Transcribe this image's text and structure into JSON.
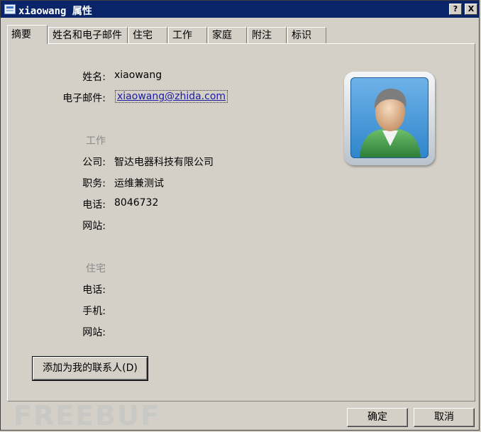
{
  "window": {
    "title": "xiaowang 属性",
    "help_label": "?",
    "close_label": "X"
  },
  "tabs": [
    {
      "label": "摘要",
      "active": true
    },
    {
      "label": "姓名和电子邮件"
    },
    {
      "label": "住宅"
    },
    {
      "label": "工作"
    },
    {
      "label": "家庭"
    },
    {
      "label": "附注"
    },
    {
      "label": "标识"
    }
  ],
  "summary": {
    "name_label": "姓名:",
    "name_value": "xiaowang",
    "email_label": "电子邮件:",
    "email_value": "xiaowang@zhida.com",
    "work_section": "工作",
    "company_label": "公司:",
    "company_value": "智达电器科技有限公司",
    "title_label": "职务:",
    "title_value": "运维兼测试",
    "phone_label": "电话:",
    "phone_value": "8046732",
    "website_label": "网站:",
    "home_section": "住宅",
    "home_phone_label": "电话:",
    "mobile_label": "手机:",
    "home_website_label": "网站:"
  },
  "buttons": {
    "add_contact": "添加为我的联系人(D)",
    "ok": "确定",
    "cancel": "取消"
  },
  "watermark": "FREEBUF",
  "icons": {
    "window_icon": "contact-card-icon",
    "avatar": "person-avatar-icon"
  },
  "colors": {
    "titlebar": "#0a246a",
    "dialog_bg": "#d4d0c8",
    "link": "#1a1aa8",
    "section_text": "#8a8a8a"
  }
}
